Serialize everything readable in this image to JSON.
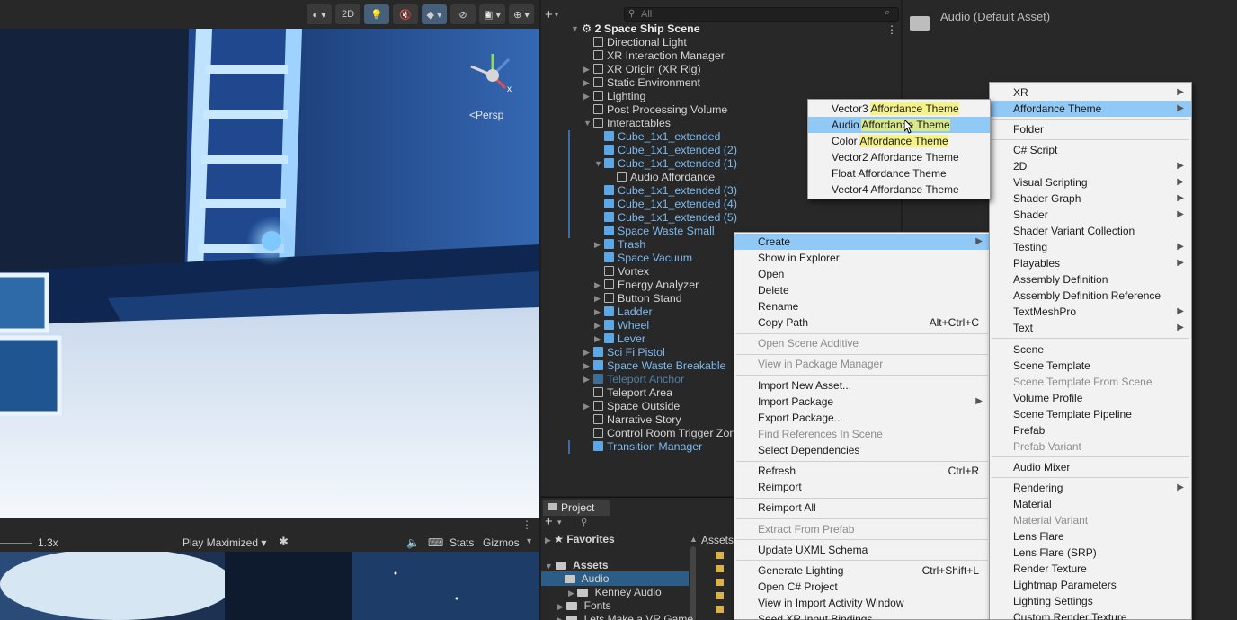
{
  "scene_view": {
    "toolbar": {
      "mode_2d": "2D"
    },
    "persp_label": "<Persp",
    "gizmo": {
      "y": "y",
      "z": "z",
      "x": "x"
    }
  },
  "game_view": {
    "scale_value": "1.3x",
    "play_mode": "Play Maximized",
    "stats": "Stats",
    "gizmos": "Gizmos"
  },
  "hierarchy": {
    "search_placeholder": "All",
    "scene_name": "2 Space Ship Scene",
    "items": [
      {
        "label": "Directional Light"
      },
      {
        "label": "XR Interaction Manager"
      },
      {
        "label": "XR Origin (XR Rig)"
      },
      {
        "label": "Static Environment"
      },
      {
        "label": "Lighting"
      },
      {
        "label": "Post Processing Volume"
      },
      {
        "label": "Interactables"
      },
      {
        "label": "Cube_1x1_extended"
      },
      {
        "label": "Cube_1x1_extended (2)"
      },
      {
        "label": "Cube_1x1_extended (1)"
      },
      {
        "label": "Audio Affordance"
      },
      {
        "label": "Cube_1x1_extended (3)"
      },
      {
        "label": "Cube_1x1_extended (4)"
      },
      {
        "label": "Cube_1x1_extended (5)"
      },
      {
        "label": "Space Waste Small"
      },
      {
        "label": "Trash"
      },
      {
        "label": "Space Vacuum"
      },
      {
        "label": "Vortex"
      },
      {
        "label": "Energy Analyzer"
      },
      {
        "label": "Button Stand"
      },
      {
        "label": "Ladder"
      },
      {
        "label": "Wheel"
      },
      {
        "label": "Lever"
      },
      {
        "label": "Sci Fi Pistol"
      },
      {
        "label": "Space Waste Breakable"
      },
      {
        "label": "Teleport Anchor"
      },
      {
        "label": "Teleport Area"
      },
      {
        "label": "Space Outside"
      },
      {
        "label": "Narrative Story"
      },
      {
        "label": "Control Room Trigger Zone"
      },
      {
        "label": "Transition Manager"
      }
    ]
  },
  "project": {
    "tab": "Project",
    "favorites": "Favorites",
    "assets": "Assets",
    "assets_header": "Assets",
    "folders": [
      "Audio",
      "Kenney Audio",
      "Fonts",
      "Lets Make a VR Game"
    ]
  },
  "inspector": {
    "title": "Audio (Default Asset)"
  },
  "context_menu": {
    "items": [
      {
        "label": "Create"
      },
      {
        "label": "Show in Explorer"
      },
      {
        "label": "Open"
      },
      {
        "label": "Delete"
      },
      {
        "label": "Rename"
      },
      {
        "label": "Copy Path",
        "shortcut": "Alt+Ctrl+C"
      },
      {
        "label": "Open Scene Additive"
      },
      {
        "label": "View in Package Manager"
      },
      {
        "label": "Import New Asset..."
      },
      {
        "label": "Import Package"
      },
      {
        "label": "Export Package..."
      },
      {
        "label": "Find References In Scene"
      },
      {
        "label": "Select Dependencies"
      },
      {
        "label": "Refresh",
        "shortcut": "Ctrl+R"
      },
      {
        "label": "Reimport"
      },
      {
        "label": "Reimport All"
      },
      {
        "label": "Extract From Prefab"
      },
      {
        "label": "Update UXML Schema"
      },
      {
        "label": "Generate Lighting",
        "shortcut": "Ctrl+Shift+L"
      },
      {
        "label": "Open C# Project"
      },
      {
        "label": "View in Import Activity Window"
      },
      {
        "label": "Seed XR Input Bindings"
      }
    ]
  },
  "create_menu": {
    "items": [
      {
        "label": "XR"
      },
      {
        "label": "Affordance Theme"
      },
      {
        "label": "Folder"
      },
      {
        "label": "C# Script"
      },
      {
        "label": "2D"
      },
      {
        "label": "Visual Scripting"
      },
      {
        "label": "Shader Graph"
      },
      {
        "label": "Shader"
      },
      {
        "label": "Shader Variant Collection"
      },
      {
        "label": "Testing"
      },
      {
        "label": "Playables"
      },
      {
        "label": "Assembly Definition"
      },
      {
        "label": "Assembly Definition Reference"
      },
      {
        "label": "TextMeshPro"
      },
      {
        "label": "Text"
      },
      {
        "label": "Scene"
      },
      {
        "label": "Scene Template"
      },
      {
        "label": "Scene Template From Scene"
      },
      {
        "label": "Volume Profile"
      },
      {
        "label": "Scene Template Pipeline"
      },
      {
        "label": "Prefab"
      },
      {
        "label": "Prefab Variant"
      },
      {
        "label": "Audio Mixer"
      },
      {
        "label": "Rendering"
      },
      {
        "label": "Material"
      },
      {
        "label": "Material Variant"
      },
      {
        "label": "Lens Flare"
      },
      {
        "label": "Lens Flare (SRP)"
      },
      {
        "label": "Render Texture"
      },
      {
        "label": "Lightmap Parameters"
      },
      {
        "label": "Lighting Settings"
      },
      {
        "label": "Custom Render Texture"
      }
    ]
  },
  "affordance_menu": {
    "items": [
      {
        "prefix": "Vector3 ",
        "label": "Affordance Theme"
      },
      {
        "prefix": "Audio ",
        "label": "Affordance Theme"
      },
      {
        "prefix": "Color ",
        "label": "Affordance Theme"
      },
      {
        "prefix": "Vector2 ",
        "label": "Affordance Theme"
      },
      {
        "prefix": "Float ",
        "label": "Affordance Theme"
      },
      {
        "prefix": "Vector4 ",
        "label": "Affordance Theme"
      }
    ]
  }
}
